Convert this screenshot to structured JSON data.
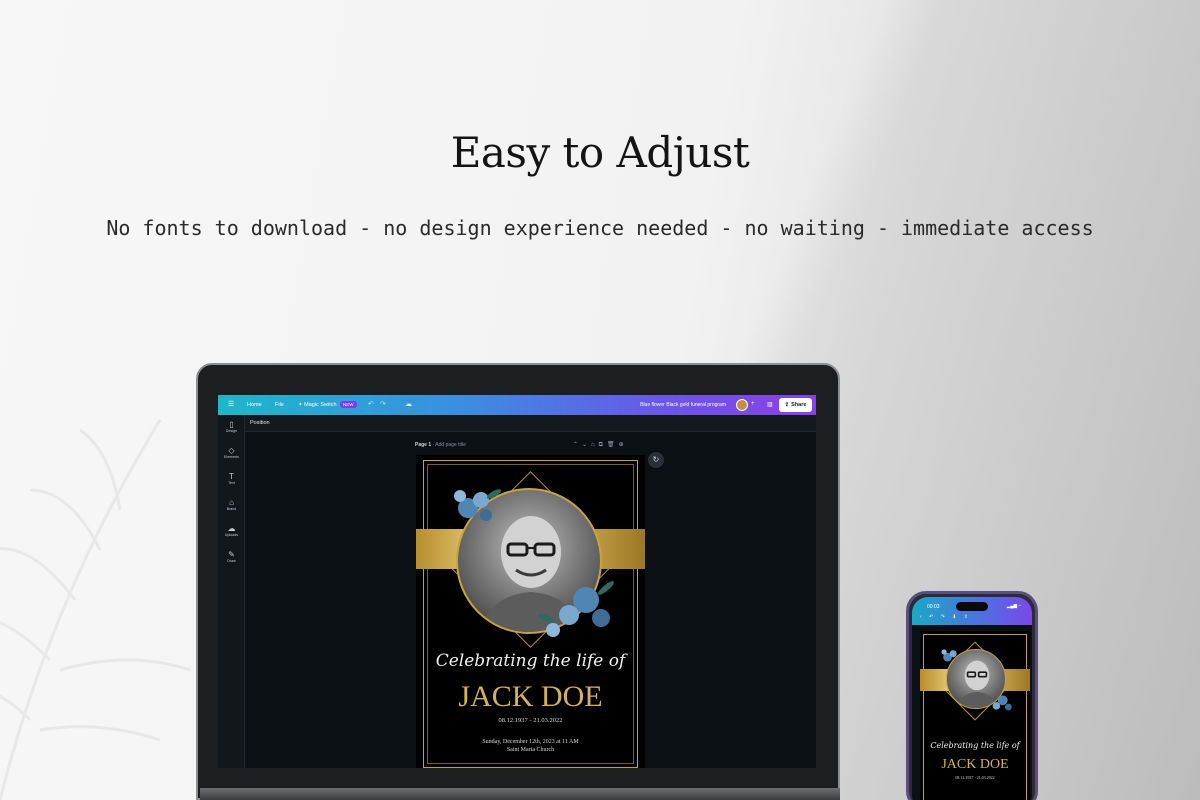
{
  "headline": "Easy to Adjust",
  "subline": "No fonts to download - no design experience needed - no waiting - immediate access",
  "editor": {
    "topbar": {
      "menu_icon": "hamburger-icon",
      "home_label": "Home",
      "file_label": "File",
      "magic_switch_label": "Magic Switch",
      "new_badge": "NEW",
      "undo_icon": "undo-icon",
      "redo_icon": "redo-icon",
      "cloud_icon": "cloud-sync-icon",
      "doc_title": "Blue flower  Black gold funeral program",
      "add_icon": "plus-icon",
      "chart_icon": "chart-icon",
      "share_label": "Share",
      "colors": {
        "gradient_start": "#1eb7c9",
        "gradient_end": "#8a3fe6"
      }
    },
    "position_label": "Position",
    "sidebar": [
      {
        "icon": "design-icon",
        "glyph": "▯",
        "label": "Design"
      },
      {
        "icon": "elements-icon",
        "glyph": "◇",
        "label": "Elements"
      },
      {
        "icon": "text-icon",
        "glyph": "T",
        "label": "Text"
      },
      {
        "icon": "brand-icon",
        "glyph": "⌂",
        "label": "Brand"
      },
      {
        "icon": "uploads-icon",
        "glyph": "☁",
        "label": "Uploads"
      },
      {
        "icon": "draw-icon",
        "glyph": "✎",
        "label": "Draw"
      }
    ],
    "page_label": "Page 1",
    "page_title_placeholder": "Add page title",
    "page_tools": [
      "chevron-up-icon",
      "chevron-down-icon",
      "lock-icon",
      "duplicate-icon",
      "delete-icon",
      "add-page-icon"
    ],
    "page_tools_glyphs": "⌃⌄⌂⧉🗑⊕"
  },
  "program": {
    "script": "Celebrating the life of",
    "name": "JACK DOE",
    "dates": "08.12.1937 - 21.03.2022",
    "service_line1": "Sunday, December 12th, 2023 at 11 AM",
    "service_line2": "Saint Maria Church",
    "gold": "#d4b25a"
  },
  "phone": {
    "time": "00:03",
    "script": "Celebrating the life of",
    "name": "JACK DOE",
    "dates": "08.12.1937 - 21.03.2022"
  }
}
